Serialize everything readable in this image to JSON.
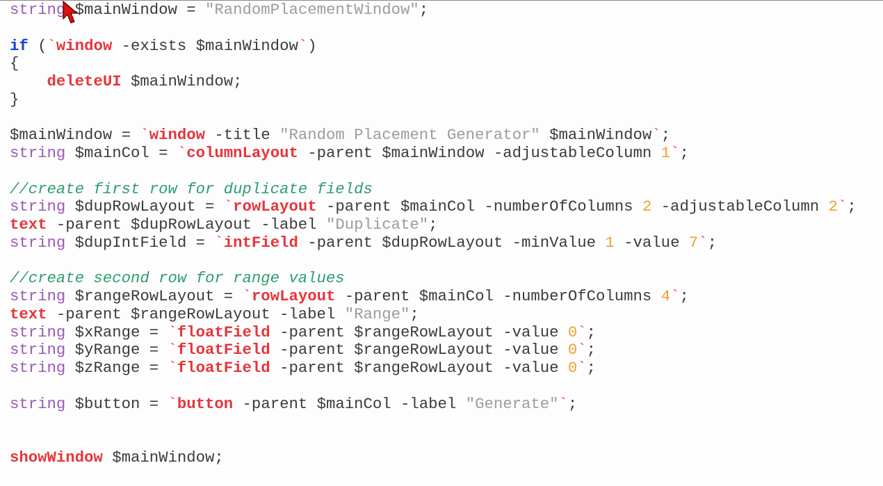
{
  "code": {
    "lines": [
      [
        {
          "t": "string",
          "c": "type"
        },
        {
          "t": " $mainWindow = ",
          "c": "plain"
        },
        {
          "t": "\"RandomPlacementWindow\"",
          "c": "str"
        },
        {
          "t": ";",
          "c": "plain"
        }
      ],
      [],
      [
        {
          "t": "if",
          "c": "kw"
        },
        {
          "t": " (",
          "c": "plain"
        },
        {
          "t": "`",
          "c": "bt"
        },
        {
          "t": "window",
          "c": "cmd"
        },
        {
          "t": " -exists $mainWindow",
          "c": "plain"
        },
        {
          "t": "`",
          "c": "bt"
        },
        {
          "t": ")",
          "c": "plain"
        }
      ],
      [
        {
          "t": "{",
          "c": "plain"
        }
      ],
      [
        {
          "t": "    ",
          "c": "plain"
        },
        {
          "t": "deleteUI",
          "c": "cmd"
        },
        {
          "t": " $mainWindow;",
          "c": "plain"
        }
      ],
      [
        {
          "t": "}",
          "c": "plain"
        }
      ],
      [],
      [
        {
          "t": "$mainWindow = ",
          "c": "plain"
        },
        {
          "t": "`",
          "c": "bt"
        },
        {
          "t": "window",
          "c": "cmd"
        },
        {
          "t": " -title ",
          "c": "plain"
        },
        {
          "t": "\"Random Placement Generator\"",
          "c": "str"
        },
        {
          "t": " $mainWindow",
          "c": "plain"
        },
        {
          "t": "`",
          "c": "bt"
        },
        {
          "t": ";",
          "c": "plain"
        }
      ],
      [
        {
          "t": "string",
          "c": "type"
        },
        {
          "t": " $mainCol = ",
          "c": "plain"
        },
        {
          "t": "`",
          "c": "bt"
        },
        {
          "t": "columnLayout",
          "c": "cmd"
        },
        {
          "t": " -parent $mainWindow -adjustableColumn ",
          "c": "plain"
        },
        {
          "t": "1",
          "c": "num"
        },
        {
          "t": "`",
          "c": "bt"
        },
        {
          "t": ";",
          "c": "plain"
        }
      ],
      [],
      [
        {
          "t": "//create first row for duplicate fields",
          "c": "cmt"
        }
      ],
      [
        {
          "t": "string",
          "c": "type"
        },
        {
          "t": " $dupRowLayout = ",
          "c": "plain"
        },
        {
          "t": "`",
          "c": "bt"
        },
        {
          "t": "rowLayout",
          "c": "cmd"
        },
        {
          "t": " -parent $mainCol -numberOfColumns ",
          "c": "plain"
        },
        {
          "t": "2",
          "c": "num"
        },
        {
          "t": " -adjustableColumn ",
          "c": "plain"
        },
        {
          "t": "2",
          "c": "num"
        },
        {
          "t": "`",
          "c": "bt"
        },
        {
          "t": ";",
          "c": "plain"
        }
      ],
      [
        {
          "t": "text",
          "c": "cmd"
        },
        {
          "t": " -parent $dupRowLayout -label ",
          "c": "plain"
        },
        {
          "t": "\"Duplicate\"",
          "c": "str"
        },
        {
          "t": ";",
          "c": "plain"
        }
      ],
      [
        {
          "t": "string",
          "c": "type"
        },
        {
          "t": " $dupIntField = ",
          "c": "plain"
        },
        {
          "t": "`",
          "c": "bt"
        },
        {
          "t": "intField",
          "c": "cmd"
        },
        {
          "t": " -parent $dupRowLayout -minValue ",
          "c": "plain"
        },
        {
          "t": "1",
          "c": "num"
        },
        {
          "t": " -value ",
          "c": "plain"
        },
        {
          "t": "7",
          "c": "num"
        },
        {
          "t": "`",
          "c": "bt"
        },
        {
          "t": ";",
          "c": "plain"
        }
      ],
      [],
      [
        {
          "t": "//create second row for range values",
          "c": "cmt"
        }
      ],
      [
        {
          "t": "string",
          "c": "type"
        },
        {
          "t": " $rangeRowLayout = ",
          "c": "plain"
        },
        {
          "t": "`",
          "c": "bt"
        },
        {
          "t": "rowLayout",
          "c": "cmd"
        },
        {
          "t": " -parent $mainCol -numberOfColumns ",
          "c": "plain"
        },
        {
          "t": "4",
          "c": "num"
        },
        {
          "t": "`",
          "c": "bt"
        },
        {
          "t": ";",
          "c": "plain"
        }
      ],
      [
        {
          "t": "text",
          "c": "cmd"
        },
        {
          "t": " -parent $rangeRowLayout -label ",
          "c": "plain"
        },
        {
          "t": "\"Range\"",
          "c": "str"
        },
        {
          "t": ";",
          "c": "plain"
        }
      ],
      [
        {
          "t": "string",
          "c": "type"
        },
        {
          "t": " $xRange = ",
          "c": "plain"
        },
        {
          "t": "`",
          "c": "bt"
        },
        {
          "t": "floatField",
          "c": "cmd"
        },
        {
          "t": " -parent $rangeRowLayout -value ",
          "c": "plain"
        },
        {
          "t": "0",
          "c": "num"
        },
        {
          "t": "`",
          "c": "bt"
        },
        {
          "t": ";",
          "c": "plain"
        }
      ],
      [
        {
          "t": "string",
          "c": "type"
        },
        {
          "t": " $yRange = ",
          "c": "plain"
        },
        {
          "t": "`",
          "c": "bt"
        },
        {
          "t": "floatField",
          "c": "cmd"
        },
        {
          "t": " -parent $rangeRowLayout -value ",
          "c": "plain"
        },
        {
          "t": "0",
          "c": "num"
        },
        {
          "t": "`",
          "c": "bt"
        },
        {
          "t": ";",
          "c": "plain"
        }
      ],
      [
        {
          "t": "string",
          "c": "type"
        },
        {
          "t": " $zRange = ",
          "c": "plain"
        },
        {
          "t": "`",
          "c": "bt"
        },
        {
          "t": "floatField",
          "c": "cmd"
        },
        {
          "t": " -parent $rangeRowLayout -value ",
          "c": "plain"
        },
        {
          "t": "0",
          "c": "num"
        },
        {
          "t": "`",
          "c": "bt"
        },
        {
          "t": ";",
          "c": "plain"
        }
      ],
      [],
      [
        {
          "t": "string",
          "c": "type"
        },
        {
          "t": " $button = ",
          "c": "plain"
        },
        {
          "t": "`",
          "c": "bt"
        },
        {
          "t": "button",
          "c": "cmd"
        },
        {
          "t": " -parent $mainCol -label ",
          "c": "plain"
        },
        {
          "t": "\"Generate\"",
          "c": "str"
        },
        {
          "t": "`",
          "c": "bt"
        },
        {
          "t": ";",
          "c": "plain"
        }
      ],
      [],
      [],
      [
        {
          "t": "showWindow",
          "c": "cmd"
        },
        {
          "t": " $mainWindow;",
          "c": "plain"
        }
      ]
    ]
  },
  "colors": {
    "type": "#9b59b6",
    "keyword": "#1a3fd6",
    "command": "#e8343b",
    "string": "#9c9c9c",
    "number": "#f0a030",
    "comment": "#2e9e6e",
    "plain": "#3b3b3b",
    "background": "#fdfdfd"
  },
  "cursor": {
    "icon": "mouse-pointer-icon"
  }
}
